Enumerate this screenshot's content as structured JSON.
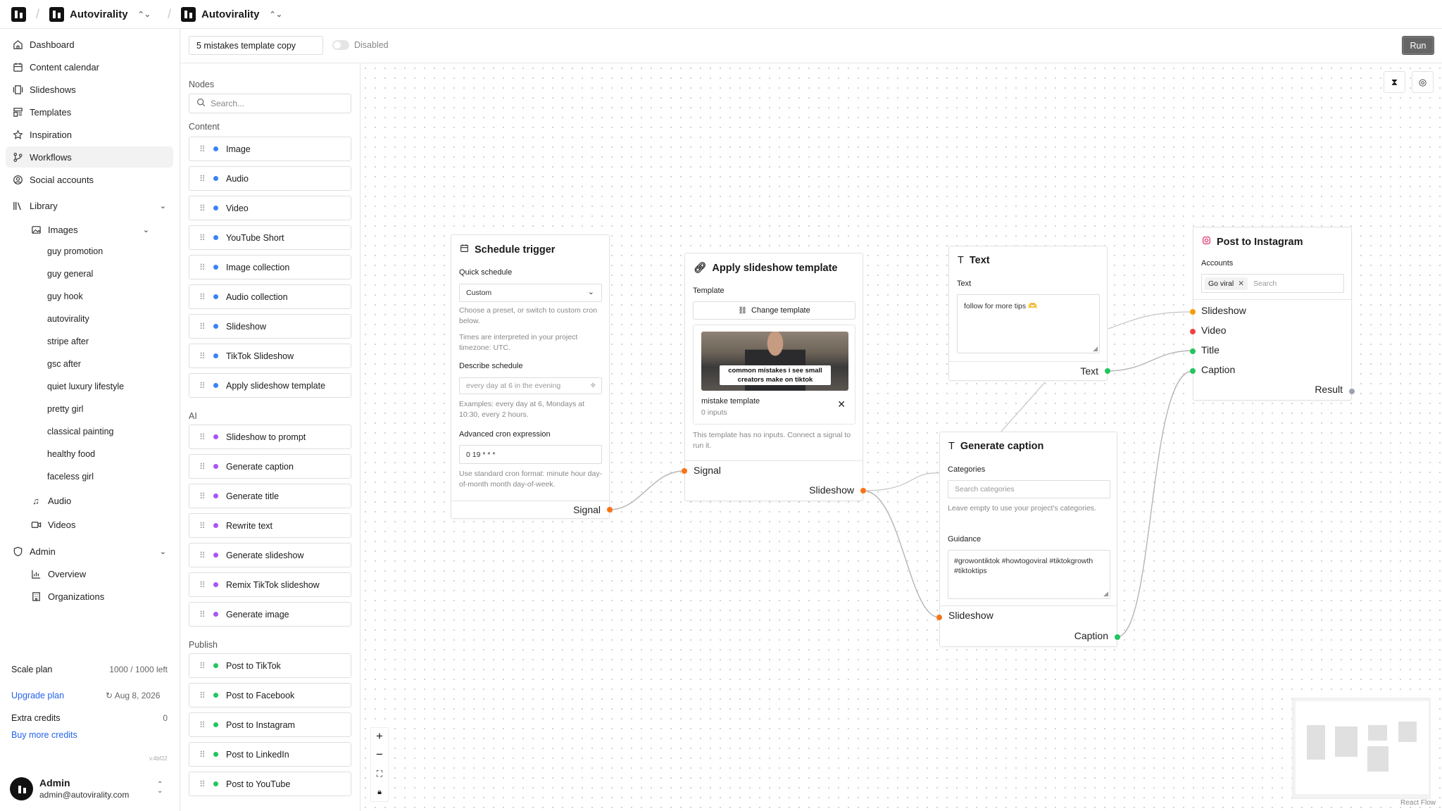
{
  "topbar": {
    "org_name": "Autovirality",
    "project_name": "Autovirality"
  },
  "sidebar": {
    "nav": [
      {
        "label": "Dashboard",
        "icon": "home-icon"
      },
      {
        "label": "Content calendar",
        "icon": "calendar-icon"
      },
      {
        "label": "Slideshows",
        "icon": "slideshow-icon"
      },
      {
        "label": "Templates",
        "icon": "template-icon"
      },
      {
        "label": "Inspiration",
        "icon": "star-icon"
      },
      {
        "label": "Workflows",
        "icon": "workflow-icon"
      },
      {
        "label": "Social accounts",
        "icon": "account-icon"
      }
    ],
    "library_label": "Library",
    "images_label": "Images",
    "image_folders": [
      "guy promotion",
      "guy general",
      "guy hook",
      "autovirality",
      "stripe after",
      "gsc after",
      "quiet luxury lifestyle",
      "pretty girl",
      "classical painting",
      "healthy food",
      "faceless girl"
    ],
    "audio_label": "Audio",
    "videos_label": "Videos",
    "admin_label": "Admin",
    "admin_items": [
      "Overview",
      "Organizations"
    ],
    "plan": {
      "name": "Scale plan",
      "usage": "1000 / 1000 left",
      "upgrade": "Upgrade plan",
      "renew_date": "Aug 8, 2026",
      "extra_label": "Extra credits",
      "extra_value": "0",
      "buy": "Buy more credits",
      "version": "v.4bf22"
    },
    "user": {
      "name": "Admin",
      "email": "admin@autovirality.com"
    }
  },
  "toolbar": {
    "workflow_name": "5 mistakes template copy",
    "toggle_label": "Disabled",
    "run_label": "Run"
  },
  "palette": {
    "title": "Nodes",
    "search_placeholder": "Search...",
    "sections": [
      {
        "name": "Content",
        "color": "#3b82f6",
        "items": [
          "Image",
          "Audio",
          "Video",
          "YouTube Short",
          "Image collection",
          "Audio collection",
          "Slideshow",
          "TikTok Slideshow",
          "Apply slideshow template"
        ]
      },
      {
        "name": "AI",
        "color": "#a855f7",
        "items": [
          "Slideshow to prompt",
          "Generate caption",
          "Generate title",
          "Rewrite text",
          "Generate slideshow",
          "Remix TikTok slideshow",
          "Generate image"
        ]
      },
      {
        "name": "Publish",
        "color": "#22c55e",
        "items": [
          "Post to TikTok",
          "Post to Facebook",
          "Post to Instagram",
          "Post to LinkedIn",
          "Post to YouTube"
        ]
      }
    ]
  },
  "nodes": {
    "schedule": {
      "title": "Schedule trigger",
      "quick_label": "Quick schedule",
      "quick_value": "Custom",
      "quick_help": "Choose a preset, or switch to custom cron below.",
      "tz_help": "Times are interpreted in your project timezone: UTC.",
      "describe_label": "Describe schedule",
      "describe_placeholder": "every day at 6 in the evening",
      "examples": "Examples: every day at 6, Mondays at 10:30, every 2 hours.",
      "cron_label": "Advanced cron expression",
      "cron_value": "0 19 * * *",
      "cron_help": "Use standard cron format: minute hour day-of-month month day-of-week.",
      "out": "Signal"
    },
    "apply": {
      "title": "Apply slideshow template",
      "template_label": "Template",
      "change_button": "Change template",
      "thumb_text": "common mistakes i see small creators make on tiktok",
      "template_name": "mistake template",
      "template_inputs": "0 inputs",
      "help": "This template has no inputs. Connect a signal to run it.",
      "in": "Signal",
      "out": "Slideshow"
    },
    "text": {
      "title": "Text",
      "field_label": "Text",
      "value": "follow for more tips 🫶",
      "out": "Text"
    },
    "caption": {
      "title": "Generate caption",
      "categories_label": "Categories",
      "categories_placeholder": "Search categories",
      "categories_help": "Leave empty to use your project's categories.",
      "guidance_label": "Guidance",
      "guidance_value": "#growontiktok #howtogoviral #tiktokgrowth #tiktoktips",
      "in": "Slideshow",
      "out": "Caption"
    },
    "instagram": {
      "title": "Post to Instagram",
      "accounts_label": "Accounts",
      "account_chip": "Go viral",
      "accounts_placeholder": "Search",
      "inputs": [
        "Slideshow",
        "Video",
        "Title",
        "Caption"
      ],
      "out": "Result"
    }
  },
  "canvas": {
    "attribution": "React Flow"
  },
  "colors": {
    "orange": "#f59e0b",
    "red": "#ef4444",
    "green": "#22c55e",
    "gray": "#9ca3af",
    "blue": "#3b82f6",
    "purple": "#a855f7",
    "link": "#2563eb"
  }
}
